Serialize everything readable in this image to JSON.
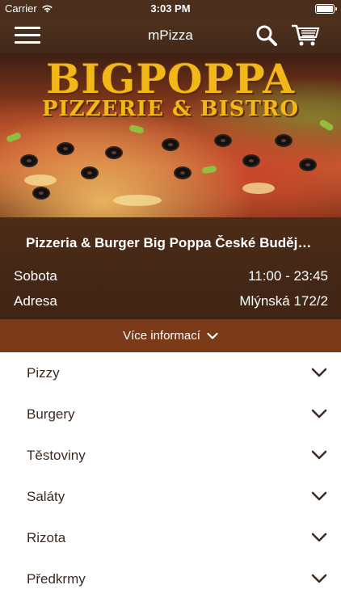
{
  "status_bar": {
    "carrier": "Carrier",
    "time": "3:03 PM"
  },
  "nav": {
    "title": "mPizza",
    "icons": [
      "menu-icon",
      "search-icon",
      "cart-icon"
    ]
  },
  "hero": {
    "logo_line1": "BIGPOPPA",
    "logo_line2": "PIZZERIE & BISTRO"
  },
  "info": {
    "restaurant_name": "Pizzeria & Burger Big Poppa České Budějovice",
    "day_label": "Sobota",
    "hours": "11:00 - 23:45",
    "address_label": "Adresa",
    "address": "Mlýnská 172/2",
    "more_info_label": "Více informací"
  },
  "categories": [
    {
      "label": "Pizzy"
    },
    {
      "label": "Burgery"
    },
    {
      "label": "Těstoviny"
    },
    {
      "label": "Saláty"
    },
    {
      "label": "Rizota"
    },
    {
      "label": "Předkrmy"
    }
  ],
  "colors": {
    "nav_bg": "#4e311d",
    "info_bg": "#4b2c18",
    "more_info_bg": "#7a3a18",
    "logo_gold": "#f2b818",
    "list_text": "#3a2a22"
  }
}
